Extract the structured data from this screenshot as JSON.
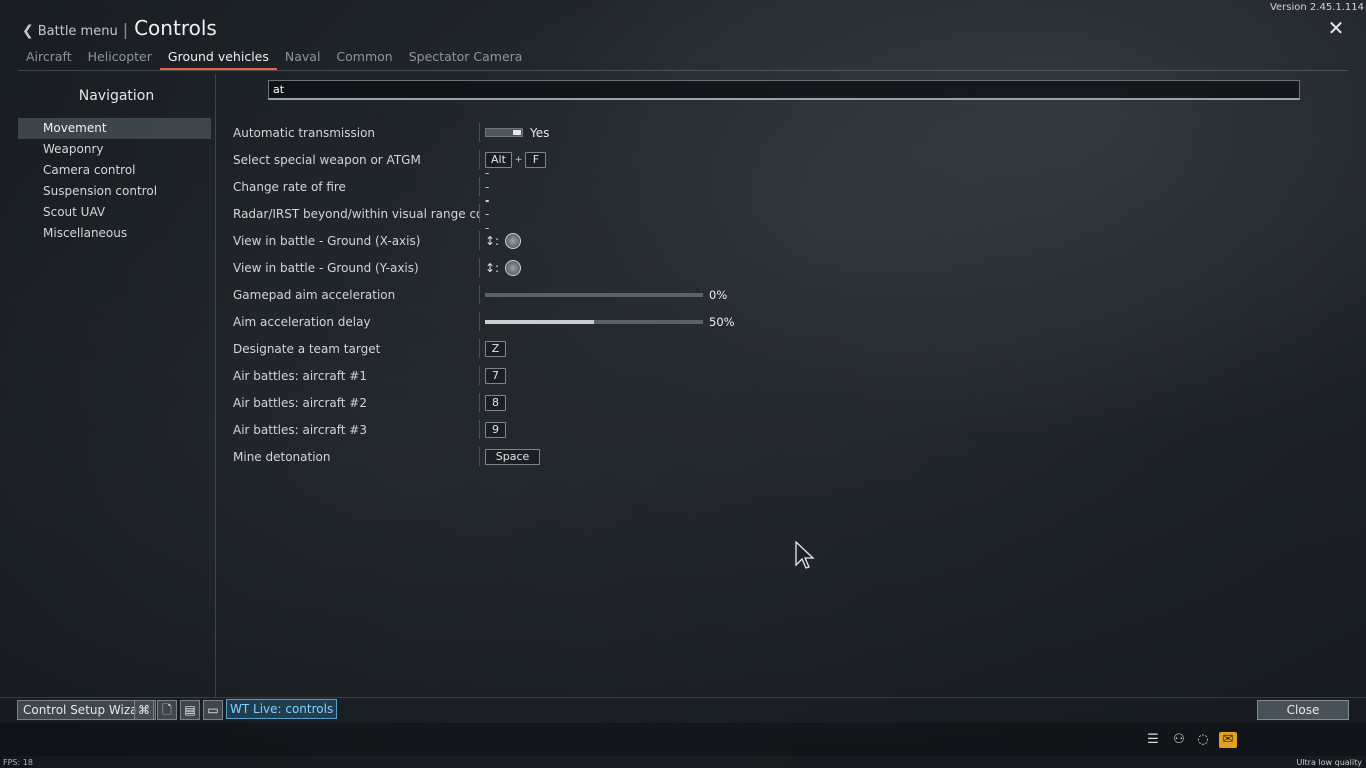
{
  "version": "Version 2.45.1.114",
  "header": {
    "back_label": "Battle menu",
    "title": "Controls"
  },
  "tabs": [
    {
      "label": "Aircraft",
      "active": false
    },
    {
      "label": "Helicopter",
      "active": false
    },
    {
      "label": "Ground vehicles",
      "active": true
    },
    {
      "label": "Naval",
      "active": false
    },
    {
      "label": "Common",
      "active": false
    },
    {
      "label": "Spectator Camera",
      "active": false
    }
  ],
  "navigation": {
    "title": "Navigation",
    "items": [
      {
        "label": "Movement",
        "active": true
      },
      {
        "label": "Weaponry",
        "active": false
      },
      {
        "label": "Camera control",
        "active": false
      },
      {
        "label": "Suspension control",
        "active": false
      },
      {
        "label": "Scout UAV",
        "active": false
      },
      {
        "label": "Miscellaneous",
        "active": false
      }
    ]
  },
  "search": {
    "value": "at"
  },
  "rows": [
    {
      "label": "Automatic transmission",
      "type": "toggle",
      "text": "Yes"
    },
    {
      "label": "Select special weapon or ATGM",
      "type": "keys",
      "keys": [
        "Alt",
        "F"
      ],
      "plus": "+"
    },
    {
      "label": "Change rate of fire",
      "type": "none",
      "text": "---"
    },
    {
      "label": "Radar/IRST beyond/within visual range comba",
      "type": "none",
      "text": "---"
    },
    {
      "label": "View in battle - Ground (X-axis)",
      "type": "axis",
      "arrows": "↕:",
      "icon": "gamepad-stick-x-icon"
    },
    {
      "label": "View in battle - Ground (Y-axis)",
      "type": "axis",
      "arrows": "↕:",
      "icon": "gamepad-stick-y-icon"
    },
    {
      "label": "Gamepad aim acceleration",
      "type": "slider",
      "value": 0,
      "text": "0%"
    },
    {
      "label": "Aim acceleration delay",
      "type": "slider",
      "value": 0.5,
      "text": "50%"
    },
    {
      "label": "Designate a team target",
      "type": "keys",
      "keys": [
        "Z"
      ]
    },
    {
      "label": "Air battles: aircraft #1",
      "type": "keys",
      "keys": [
        "7"
      ]
    },
    {
      "label": "Air battles: aircraft #2",
      "type": "keys",
      "keys": [
        "8"
      ]
    },
    {
      "label": "Air battles: aircraft #3",
      "type": "keys",
      "keys": [
        "9"
      ]
    },
    {
      "label": "Mine detonation",
      "type": "keys",
      "keys": [
        "Space"
      ]
    }
  ],
  "footer": {
    "wizard_label": "Control Setup Wizard",
    "icons": [
      "gamepad-icon",
      "new-preset-icon",
      "save-icon",
      "open-folder-icon"
    ],
    "wt_live_label": "WT Live: controls",
    "close_label": "Close"
  },
  "status": {
    "fps": "FPS: 18",
    "quality": "Ultra low quality",
    "tray_icons": [
      "list-icon",
      "squad-icon",
      "chat-icon",
      "mail-icon"
    ]
  },
  "colors": {
    "accent_tab": "#e0654a",
    "wt_live": "#7fd3ff",
    "mail": "#e2a21d"
  }
}
